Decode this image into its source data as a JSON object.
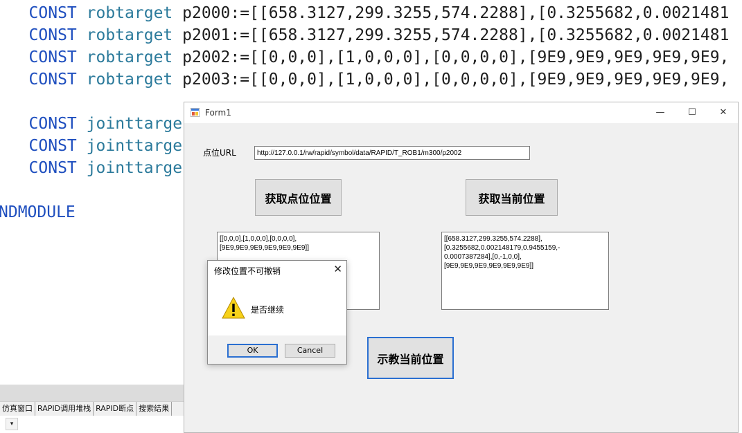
{
  "editor": {
    "lines": [
      {
        "kw": "CONST",
        "type": "robtarget",
        "rest": "p2000:=[[658.3127,299.3255,574.2288],[0.3255682,0.0021481"
      },
      {
        "kw": "CONST",
        "type": "robtarget",
        "rest": "p2001:=[[658.3127,299.3255,574.2288],[0.3255682,0.0021481"
      },
      {
        "kw": "CONST",
        "type": "robtarget",
        "rest": "p2002:=[[0,0,0],[1,0,0,0],[0,0,0,0],[9E9,9E9,9E9,9E9,9E9,"
      },
      {
        "kw": "CONST",
        "type": "robtarget",
        "rest": "p2003:=[[0,0,0],[1,0,0,0],[0,0,0,0],[9E9,9E9,9E9,9E9,9E9,"
      },
      {
        "kw": "CONST",
        "type": "jointtarge",
        "rest": ""
      },
      {
        "kw": "CONST",
        "type": "jointtarge",
        "rest": ""
      },
      {
        "kw": "CONST",
        "type": "jointtarge",
        "rest": ""
      },
      {
        "kw": "NDMODULE",
        "type": "",
        "rest": ""
      }
    ]
  },
  "panel": {
    "tabs": [
      "仿真窗口",
      "RAPID调用堆栈",
      "RAPID断点",
      "搜索结果"
    ],
    "dropdown_glyph": "▾"
  },
  "form": {
    "title": "Form1",
    "minimize": "—",
    "maximize": "☐",
    "close": "✕",
    "url_label": "点位URL",
    "url_value": "http://127.0.0.1/rw/rapid/symbol/data/RAPID/T_ROB1/m300/p2002",
    "get_point_button": "获取点位位置",
    "get_current_button": "获取当前位置",
    "teach_button": "示教当前位置",
    "point_text": "[[0,0,0],[1,0,0,0],[0,0,0,0],\n[9E9,9E9,9E9,9E9,9E9,9E9]]",
    "current_text": "[[658.3127,299.3255,574.2288],\n[0.3255682,0.002148179,0.9455159,-\n0.0007387284],[0,-1,0,0],\n[9E9,9E9,9E9,9E9,9E9,9E9]]"
  },
  "dialog": {
    "title": "修改位置不可撤销",
    "close": "✕",
    "message": "是否继续",
    "ok": "OK",
    "cancel": "Cancel"
  },
  "colors": {
    "keyword": "#1f4fbf",
    "type": "#2b7a9b",
    "focus_border": "#2a6fd1",
    "warning_fill": "#f7d21a"
  }
}
